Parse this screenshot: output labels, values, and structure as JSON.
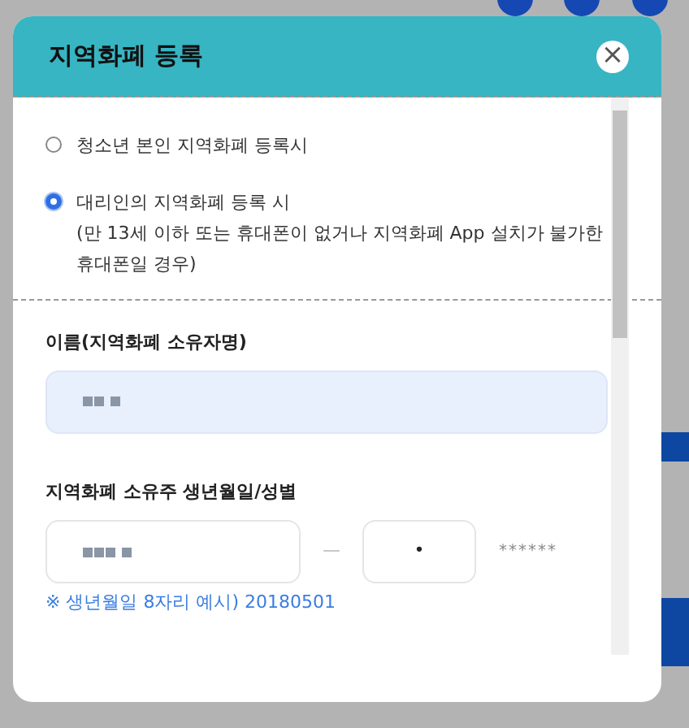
{
  "modal": {
    "title": "지역화폐 등록",
    "close": "×"
  },
  "options": [
    {
      "label": "청소년 본인 지역화폐 등록시",
      "selected": false
    },
    {
      "label": "대리인의 지역화폐 등록 시",
      "note": "(만 13세 이하 또는 휴대폰이 없거나 지역화폐 App 설치가 불가한 휴대폰일 경우)",
      "selected": true
    }
  ],
  "name_field": {
    "label": "이름(지역화폐 소유자명)"
  },
  "birth_field": {
    "label": "지역화폐 소유주 생년월일/성별",
    "separator": "—",
    "gender_value": "•",
    "masked": "******",
    "hint": "※ 생년월일 8자리 예시) 20180501"
  }
}
